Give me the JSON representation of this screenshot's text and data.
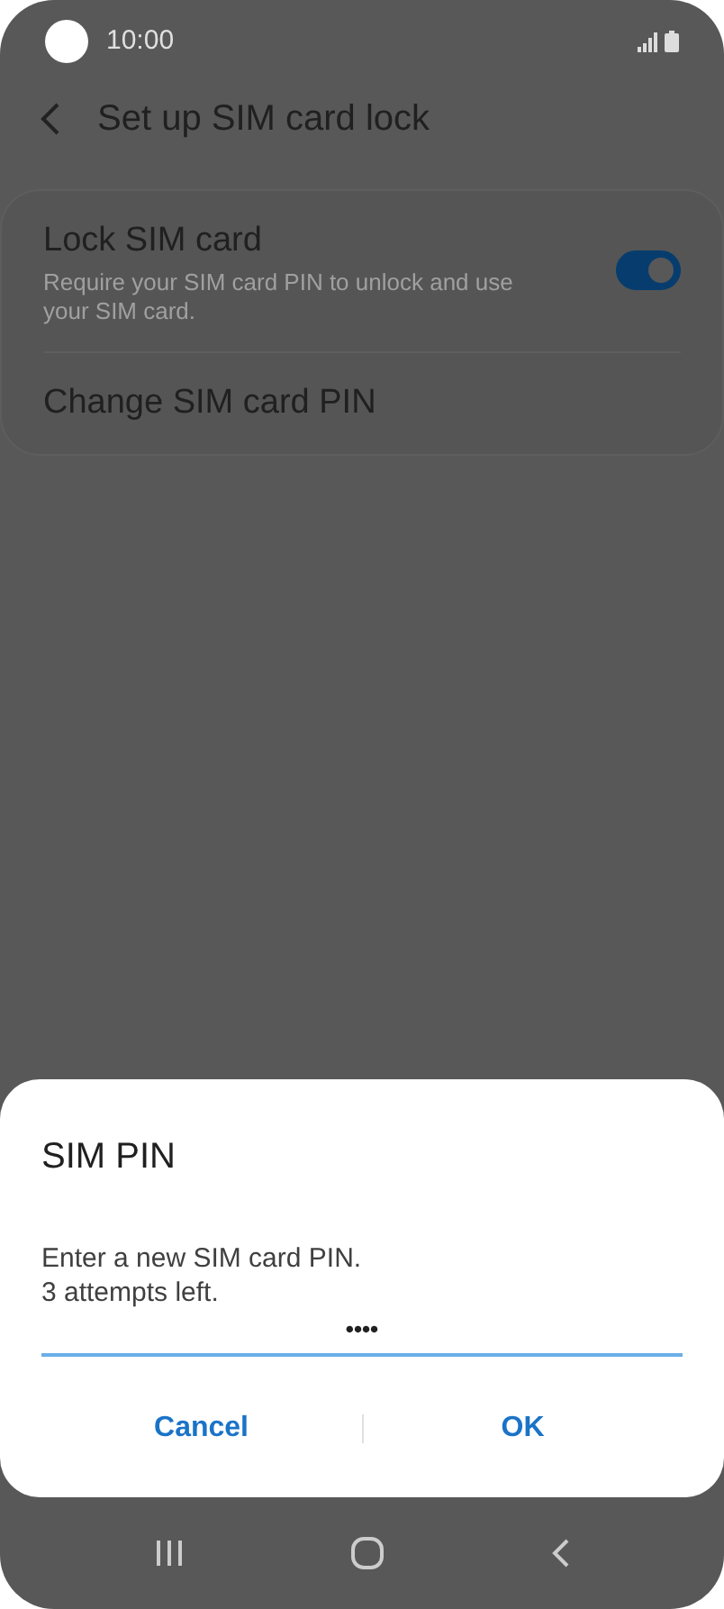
{
  "status_bar": {
    "time": "10:00"
  },
  "header": {
    "title": "Set up SIM card lock"
  },
  "settings": [
    {
      "kind": "toggle",
      "title": "Lock SIM card",
      "subtitle": "Require your SIM card PIN to unlock and use your SIM card.",
      "on": true
    },
    {
      "kind": "link",
      "title": "Change SIM card PIN"
    }
  ],
  "dialog": {
    "title": "SIM PIN",
    "message": "Enter a new SIM card PIN.\n3 attempts left.",
    "pin_field": {
      "value": "••••"
    },
    "buttons": [
      "Cancel",
      "OK"
    ]
  }
}
